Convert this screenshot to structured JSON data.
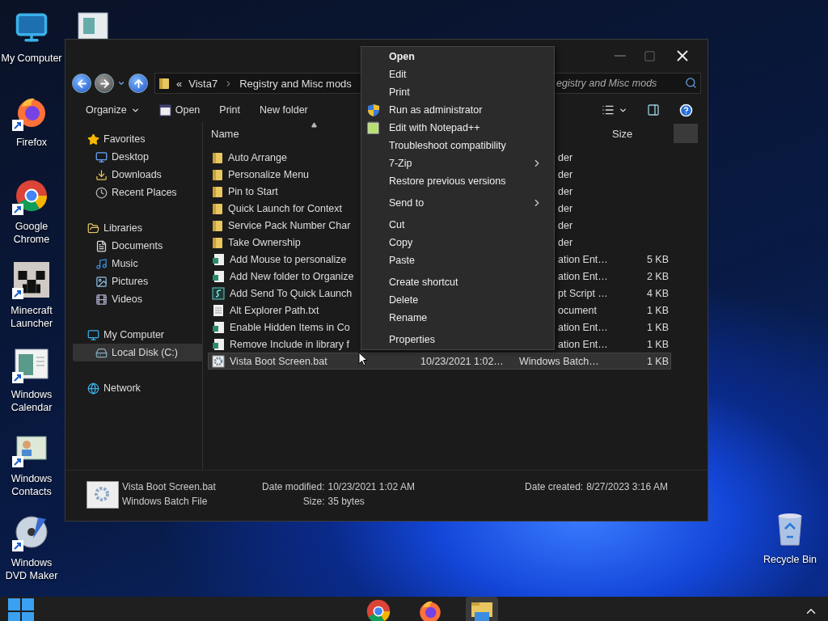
{
  "desktop_icons": [
    {
      "label": "My Computer",
      "shortcut": false
    },
    {
      "label": "Firefox",
      "shortcut": true
    },
    {
      "label": "Google Chrome",
      "shortcut": true
    },
    {
      "label": "Minecraft Launcher",
      "shortcut": true
    },
    {
      "label": "Windows Calendar",
      "shortcut": true
    },
    {
      "label": "Windows Contacts",
      "shortcut": true
    },
    {
      "label": "Windows DVD Maker",
      "shortcut": true
    }
  ],
  "recycle_bin": {
    "label": "Recycle Bin"
  },
  "explorer": {
    "address": {
      "overflow": "«",
      "crumbs": [
        "Vista7",
        "Registry and Misc mods"
      ]
    },
    "search": {
      "placeholder": "egistry and Misc mods"
    },
    "toolbar": {
      "organize": "Organize",
      "commands": [
        "Open",
        "Print",
        "New folder"
      ]
    },
    "nav": [
      {
        "label": "Favorites",
        "selected": false,
        "children": [
          {
            "label": "Desktop",
            "selected": false
          },
          {
            "label": "Downloads",
            "selected": false
          },
          {
            "label": "Recent Places",
            "selected": false
          }
        ]
      },
      {
        "label": "Libraries",
        "selected": false,
        "children": [
          {
            "label": "Documents",
            "selected": false
          },
          {
            "label": "Music",
            "selected": false
          },
          {
            "label": "Pictures",
            "selected": false
          },
          {
            "label": "Videos",
            "selected": false
          }
        ]
      },
      {
        "label": "My Computer",
        "selected": false,
        "children": [
          {
            "label": "Local Disk (C:)",
            "selected": true
          }
        ]
      },
      {
        "label": "Network",
        "selected": false
      }
    ],
    "header": {
      "name": "Name",
      "size": "Size"
    },
    "files": [
      {
        "kind": "folder",
        "name": "Auto Arrange",
        "type": "der",
        "selected": false
      },
      {
        "kind": "folder",
        "name": "Personalize Menu",
        "type": "der",
        "selected": false
      },
      {
        "kind": "folder",
        "name": "Pin to Start",
        "type": "der",
        "selected": false
      },
      {
        "kind": "folder",
        "name": "Quick Launch for Context",
        "type": "der",
        "selected": false
      },
      {
        "kind": "folder",
        "name": "Service Pack Number Char",
        "type": "der",
        "selected": false
      },
      {
        "kind": "folder",
        "name": "Take Ownership",
        "type": "der",
        "selected": false
      },
      {
        "kind": "registry",
        "name": "Add Mouse to personalize",
        "type": "ation Ent…",
        "size": "5 KB",
        "selected": false
      },
      {
        "kind": "registry",
        "name": "Add New folder to Organize",
        "type": "ation Ent…",
        "size": "2 KB",
        "selected": false
      },
      {
        "kind": "script",
        "name": "Add Send To Quick Launch",
        "type": "pt Script …",
        "size": "4 KB",
        "selected": false
      },
      {
        "kind": "text",
        "name": "Alt Explorer Path.txt",
        "type": "ocument",
        "size": "1 KB",
        "selected": false
      },
      {
        "kind": "registry",
        "name": "Enable Hidden Items in Co",
        "type": "ation Ent…",
        "size": "1 KB",
        "selected": false
      },
      {
        "kind": "registry",
        "name": "Remove Include in library f",
        "type": "ation Ent…",
        "size": "1 KB",
        "selected": false
      },
      {
        "kind": "batch",
        "name": "Vista Boot Screen.bat",
        "date": "10/23/2021 1:02…",
        "type": "Windows Batch…",
        "size": "1 KB",
        "selected": true
      }
    ],
    "details": {
      "name": "Vista Boot Screen.bat",
      "type": "Windows Batch File",
      "fields": [
        {
          "label": "Date modified:",
          "value": "10/23/2021 1:02 AM"
        },
        {
          "label": "Size:",
          "value": "35 bytes"
        },
        {
          "label": "Date created:",
          "value": "8/27/2023 3:16 AM"
        }
      ]
    }
  },
  "context_menu": {
    "groups": [
      [
        {
          "label": "Open",
          "kind": "plain",
          "default": true,
          "submenu": false
        },
        {
          "label": "Edit",
          "kind": "plain",
          "default": false,
          "submenu": false
        },
        {
          "label": "Print",
          "kind": "plain",
          "default": false,
          "submenu": false
        },
        {
          "label": "Run as administrator",
          "kind": "elevated",
          "default": false,
          "submenu": false
        },
        {
          "label": "Edit with Notepad++",
          "kind": "app",
          "default": false,
          "submenu": false
        },
        {
          "label": "Troubleshoot compatibility",
          "kind": "plain",
          "default": false,
          "submenu": false
        },
        {
          "label": "7-Zip",
          "kind": "plain",
          "default": false,
          "submenu": true
        },
        {
          "label": "Restore previous versions",
          "kind": "plain",
          "default": false,
          "submenu": false
        }
      ],
      [
        {
          "label": "Send to",
          "kind": "plain",
          "default": false,
          "submenu": true
        }
      ],
      [
        {
          "label": "Cut",
          "kind": "plain",
          "default": false,
          "submenu": false
        },
        {
          "label": "Copy",
          "kind": "plain",
          "default": false,
          "submenu": false
        },
        {
          "label": "Paste",
          "kind": "plain",
          "default": false,
          "submenu": false
        }
      ],
      [
        {
          "label": "Create shortcut",
          "kind": "plain",
          "default": false,
          "submenu": false
        },
        {
          "label": "Delete",
          "kind": "plain",
          "default": false,
          "submenu": false
        },
        {
          "label": "Rename",
          "kind": "plain",
          "default": false,
          "submenu": false
        }
      ],
      [
        {
          "label": "Properties",
          "kind": "plain",
          "default": false,
          "submenu": false
        }
      ]
    ]
  },
  "taskbar": {
    "apps": [
      {
        "selected": false
      },
      {
        "selected": false
      },
      {
        "selected": true
      }
    ]
  }
}
